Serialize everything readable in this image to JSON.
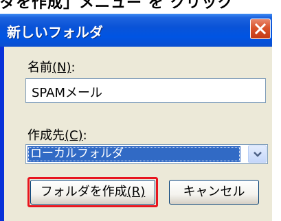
{
  "background_strip": {
    "text": "ダを作成」メニュー を クリック"
  },
  "dialog": {
    "title": "新しいフォルダ",
    "close_icon": "close-icon",
    "name_label": "名前",
    "name_accesskey": "(N)",
    "name_suffix": ":",
    "name_value": "SPAMメール",
    "destination_label": "作成先",
    "destination_accesskey": "(C)",
    "destination_suffix": ":",
    "destination_value": "ローカルフォルダ",
    "create_button": "フォルダを作成",
    "create_accesskey": "(R)",
    "cancel_button": "キャンセル"
  },
  "colors": {
    "titlebar": "#0054e3",
    "client_background": "#ece9d8",
    "selection": "#316ac5",
    "highlight_box": "#e8151e",
    "close_button": "#d9532c"
  }
}
